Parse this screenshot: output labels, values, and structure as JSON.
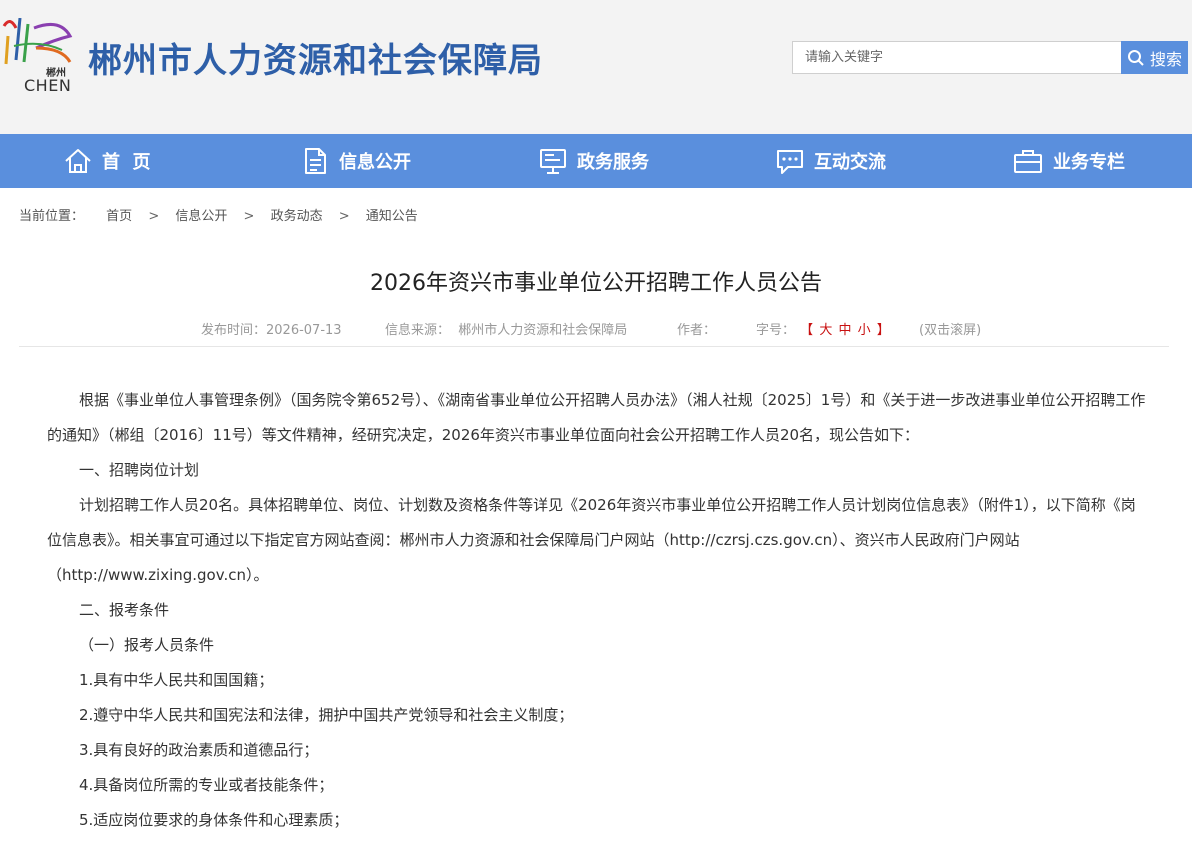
{
  "header": {
    "logo_char": "郴州",
    "logo_text": "CHEN",
    "site_title": "郴州市人力资源和社会保障局",
    "search_placeholder": "请输入关键字",
    "search_label": "搜索"
  },
  "nav": {
    "items": [
      {
        "label": "首  页",
        "icon": "home-icon"
      },
      {
        "label": "信息公开",
        "icon": "document-icon"
      },
      {
        "label": "政务服务",
        "icon": "monitor-icon"
      },
      {
        "label": "互动交流",
        "icon": "chat-icon"
      },
      {
        "label": "业务专栏",
        "icon": "briefcase-icon"
      }
    ]
  },
  "breadcrumb": {
    "lead": "当前位置：",
    "items": [
      "首页",
      "信息公开",
      "政务动态",
      "通知公告"
    ],
    "separator": ">"
  },
  "article": {
    "title": "2026年资兴市事业单位公开招聘工作人员公告",
    "publish_time": "发布时间：2026-07-13",
    "source": "信息来源：  郴州市人力资源和社会保障局",
    "author": "作者：",
    "font_size_label": "字号：",
    "bracket_open": "【",
    "bracket_close": "】",
    "size_large": "大",
    "size_medium": "中",
    "size_small": "小",
    "scroll_hint": "(双击滚屏)",
    "paragraphs": [
      "根据《事业单位人事管理条例》（国务院令第652号）、《湖南省事业单位公开招聘人员办法》（湘人社规〔2025〕1号）和《关于进一步改进事业单位公开招聘工作的通知》（郴组〔2016〕11号）等文件精神，经研究决定，2026年资兴市事业单位面向社会公开招聘工作人员20名，现公告如下：",
      "一、招聘岗位计划",
      "计划招聘工作人员20名。具体招聘单位、岗位、计划数及资格条件等详见《2026年资兴市事业单位公开招聘工作人员计划岗位信息表》（附件1），以下简称《岗位信息表》。相关事宜可通过以下指定官方网站查阅：郴州市人力资源和社会保障局门户网站（http://czrsj.czs.gov.cn）、资兴市人民政府门户网站（http://www.zixing.gov.cn）。",
      "二、报考条件",
      "（一）报考人员条件",
      "1.具有中华人民共和国国籍；",
      "2.遵守中华人民共和国宪法和法律，拥护中国共产党领导和社会主义制度；",
      "3.具有良好的政治素质和道德品行；",
      "4.具备岗位所需的专业或者技能条件；",
      "5.适应岗位要求的身体条件和心理素质；"
    ]
  },
  "colors": {
    "brand_blue": "#2e5fa8",
    "nav_blue": "#5a8fdd",
    "accent_red": "#c81010"
  }
}
